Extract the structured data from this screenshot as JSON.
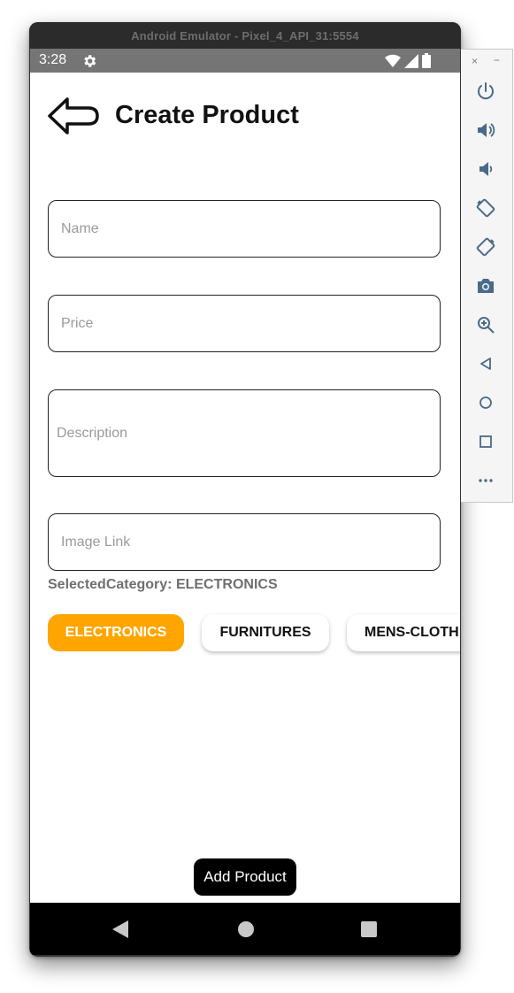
{
  "emulator": {
    "window_title": "Android Emulator - Pixel_4_API_31:5554"
  },
  "status_bar": {
    "time": "3:28",
    "icons": [
      "gear-icon",
      "wifi-icon",
      "signal-icon",
      "battery-icon"
    ]
  },
  "header": {
    "back_icon": "back-arrow-icon",
    "title": "Create Product"
  },
  "form": {
    "name": {
      "value": "",
      "placeholder": "Name"
    },
    "price": {
      "value": "",
      "placeholder": "Price"
    },
    "description": {
      "value": "",
      "placeholder": "Description"
    },
    "image_link": {
      "value": "",
      "placeholder": "Image Link"
    }
  },
  "category": {
    "selected_text": "SelectedCategory: ELECTRONICS",
    "selected": "ELECTRONICS",
    "chips": [
      {
        "label": "ELECTRONICS",
        "selected": true
      },
      {
        "label": "FURNITURES",
        "selected": false
      },
      {
        "label": "MENS-CLOTH",
        "selected": false
      }
    ]
  },
  "actions": {
    "add_product_label": "Add Product"
  },
  "nav_bar": {
    "items": [
      "back-icon",
      "home-icon",
      "recents-icon"
    ]
  },
  "side_panel": {
    "close_label": "×",
    "minimize_label": "−",
    "tools": [
      "power-icon",
      "volume-up-icon",
      "volume-down-icon",
      "rotate-left-icon",
      "rotate-right-icon",
      "camera-icon",
      "zoom-icon",
      "back-icon",
      "home-icon",
      "overview-icon",
      "more-icon"
    ]
  },
  "colors": {
    "accent": "#FFA500",
    "text_muted": "#6F6F6F",
    "status_bar": "#757575",
    "panel_icons": "#4A6A8A"
  }
}
